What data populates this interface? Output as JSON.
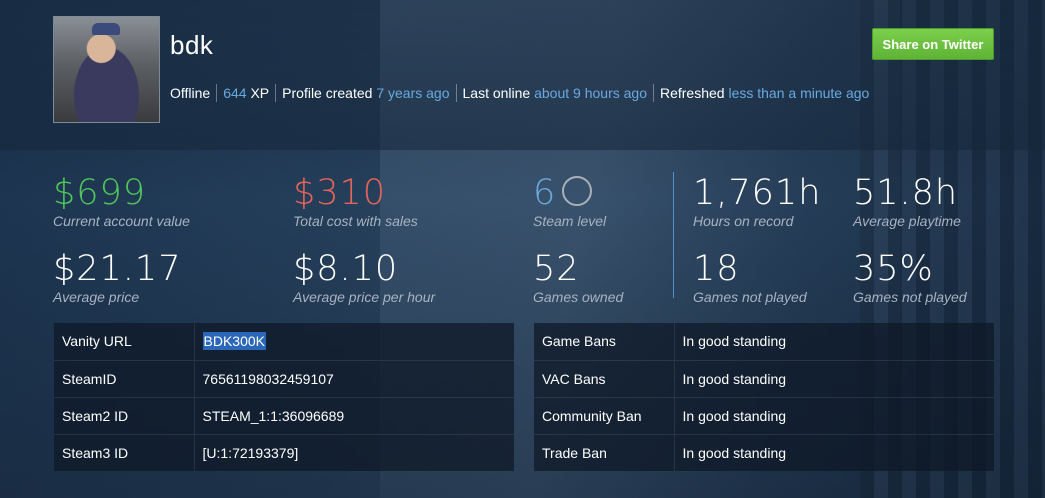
{
  "profile": {
    "username": "bdk",
    "status": "Offline",
    "xp_value": "644",
    "xp_unit": "XP",
    "created_label": "Profile created",
    "created_value": "7 years ago",
    "last_online_label": "Last online",
    "last_online_value": "about 9 hours ago",
    "refreshed_label": "Refreshed",
    "refreshed_value": "less than a minute ago"
  },
  "share_button": "Share on Twitter",
  "stats": {
    "account_value": {
      "value": "$699",
      "label": "Current account value"
    },
    "total_cost": {
      "value": "$310",
      "label": "Total cost with sales"
    },
    "steam_level": {
      "value": "6",
      "label": "Steam level"
    },
    "hours": {
      "value": "1,761h",
      "label": "Hours on record"
    },
    "avg_playtime": {
      "value": "51.8h",
      "label": "Average playtime"
    },
    "avg_price": {
      "value": "$21.17",
      "label": "Average price"
    },
    "avg_price_hour": {
      "value": "$8.10",
      "label": "Average price per hour"
    },
    "games_owned": {
      "value": "52",
      "label": "Games owned"
    },
    "games_not_played": {
      "value": "18",
      "label": "Games not played"
    },
    "pct_not_played": {
      "value": "35%",
      "label": "Games not played"
    }
  },
  "ids": [
    {
      "key": "Vanity URL",
      "value": "BDK300K"
    },
    {
      "key": "SteamID",
      "value": "76561198032459107"
    },
    {
      "key": "Steam2 ID",
      "value": "STEAM_1:1:36096689"
    },
    {
      "key": "Steam3 ID",
      "value": "[U:1:72193379]"
    }
  ],
  "bans": [
    {
      "key": "Game Bans",
      "value": "In good standing"
    },
    {
      "key": "VAC Bans",
      "value": "In good standing"
    },
    {
      "key": "Community Ban",
      "value": "In good standing"
    },
    {
      "key": "Trade Ban",
      "value": "In good standing"
    }
  ],
  "colors": {
    "green": "#4fc55a",
    "red": "#e5645a",
    "blue": "#6aa9e0",
    "button": "#6cc142"
  }
}
